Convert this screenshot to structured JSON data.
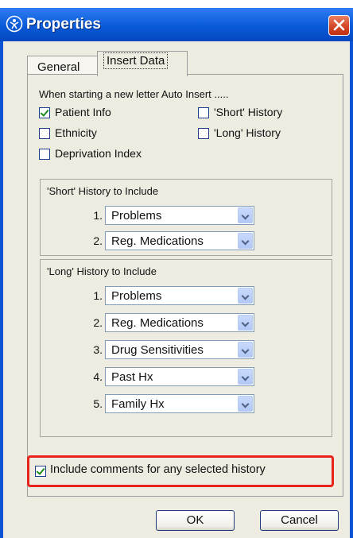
{
  "window": {
    "title": "Properties"
  },
  "tabs": [
    {
      "label": "General"
    },
    {
      "label": "Insert Data"
    }
  ],
  "auto_insert": {
    "heading": "When starting a new letter Auto Insert .....",
    "options": [
      {
        "label": "Patient Info",
        "checked": true
      },
      {
        "label": "Ethnicity",
        "checked": false
      },
      {
        "label": "Deprivation Index",
        "checked": false
      },
      {
        "label": "'Short' History",
        "checked": false
      },
      {
        "label": "'Long' History",
        "checked": false
      }
    ]
  },
  "short_history": {
    "title": "'Short' History to Include",
    "items": [
      {
        "num": "1.",
        "value": "Problems"
      },
      {
        "num": "2.",
        "value": "Reg. Medications"
      }
    ]
  },
  "long_history": {
    "title": "'Long' History to Include",
    "items": [
      {
        "num": "1.",
        "value": "Problems"
      },
      {
        "num": "2.",
        "value": "Reg. Medications"
      },
      {
        "num": "3.",
        "value": "Drug Sensitivities"
      },
      {
        "num": "4.",
        "value": "Past Hx"
      },
      {
        "num": "5.",
        "value": "Family Hx"
      }
    ]
  },
  "include_comments": {
    "label": "Include comments for any selected history",
    "checked": true
  },
  "buttons": {
    "ok": "OK",
    "cancel": "Cancel"
  },
  "colors": {
    "highlight": "#e8231b",
    "titlebar": "#0a5bd9",
    "close": "#d24425"
  }
}
